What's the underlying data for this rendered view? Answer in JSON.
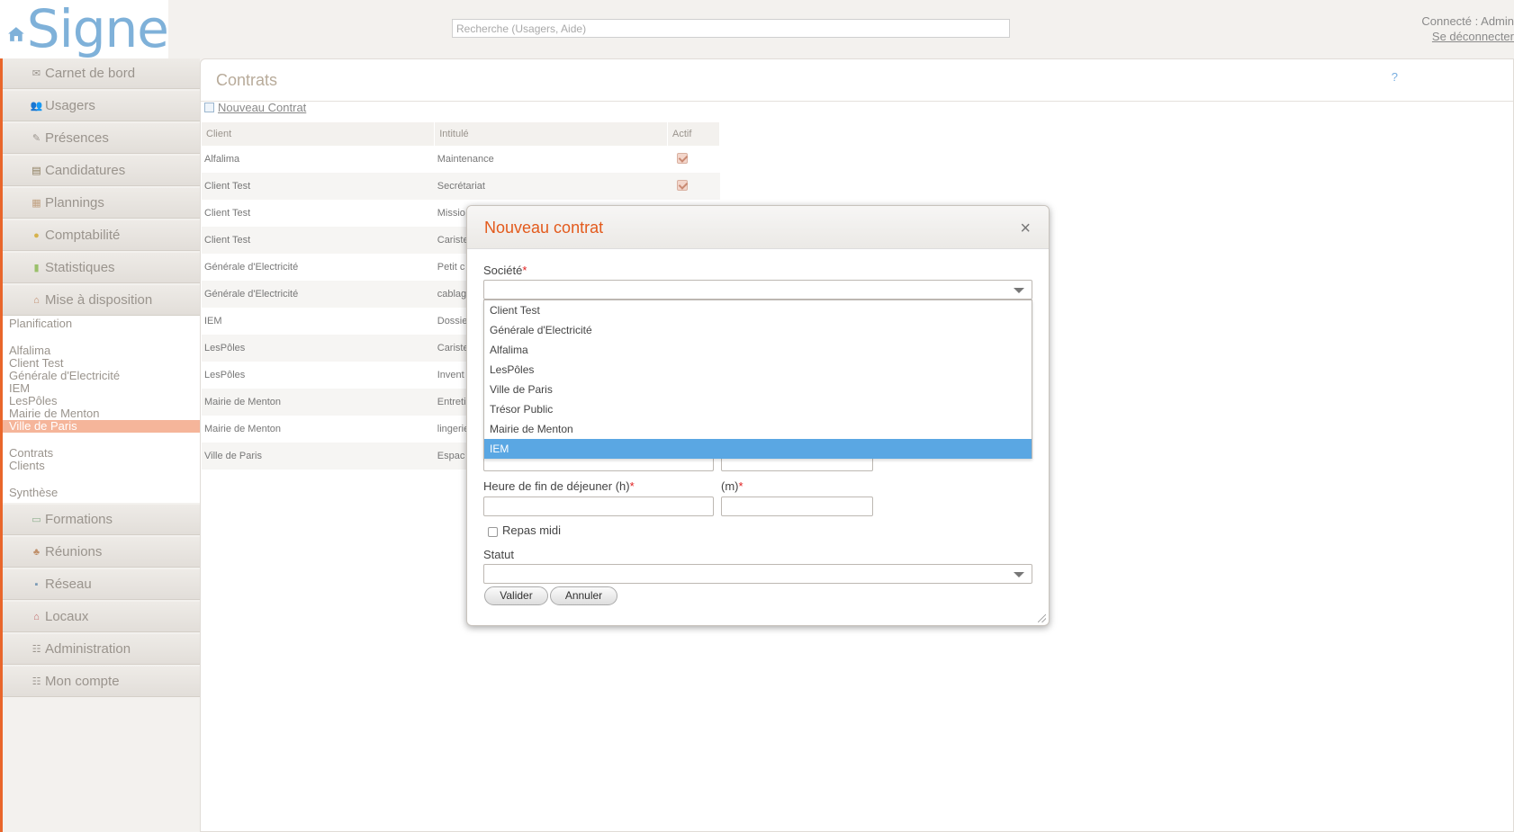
{
  "header": {
    "logo_text": "Signe",
    "search_placeholder": "Recherche (Usagers, Aide)",
    "connected_label": "Connecté : Admin",
    "logout_label": "Se déconnecter"
  },
  "sidebar": {
    "nav_top": [
      {
        "label": "Carnet de bord",
        "icon": "envelope-icon"
      },
      {
        "label": "Usagers",
        "icon": "users-icon"
      },
      {
        "label": "Présences",
        "icon": "pen-icon"
      },
      {
        "label": "Candidatures",
        "icon": "folder-icon"
      },
      {
        "label": "Plannings",
        "icon": "calendar-icon"
      },
      {
        "label": "Comptabilité",
        "icon": "coins-icon"
      },
      {
        "label": "Statistiques",
        "icon": "bar-chart-icon"
      },
      {
        "label": "Mise à disposition",
        "icon": "house-icon"
      }
    ],
    "panel": {
      "section_planification": "Planification",
      "clients": [
        "Alfalima",
        "Client Test",
        "Générale d'Electricité",
        "IEM",
        "LesPôles",
        "Mairie de Menton",
        "Ville de Paris"
      ],
      "selected_client": "Ville de Paris",
      "contracts_link": "Contrats",
      "clients_link": "Clients",
      "section_synthese": "Synthèse"
    },
    "nav_bottom": [
      {
        "label": "Formations",
        "icon": "board-icon"
      },
      {
        "label": "Réunions",
        "icon": "meeting-icon"
      },
      {
        "label": "Réseau",
        "icon": "network-icon"
      },
      {
        "label": "Locaux",
        "icon": "building-icon"
      },
      {
        "label": "Administration",
        "icon": "list-icon"
      },
      {
        "label": "Mon compte",
        "icon": "list-icon"
      }
    ]
  },
  "main": {
    "title": "Contrats",
    "help_label": "?",
    "new_contract_link": "Nouveau Contrat",
    "table": {
      "headers": [
        "Client",
        "Intitulé",
        "Actif"
      ],
      "rows": [
        {
          "client": "Alfalima",
          "title": "Maintenance",
          "active": true
        },
        {
          "client": "Client Test",
          "title": "Secrétariat",
          "active": true
        },
        {
          "client": "Client Test",
          "title": "Missio",
          "active": false
        },
        {
          "client": "Client Test",
          "title": "Cariste",
          "active": false
        },
        {
          "client": "Générale d'Electricité",
          "title": "Petit c",
          "active": false
        },
        {
          "client": "Générale d'Electricité",
          "title": "cablag",
          "active": false
        },
        {
          "client": "IEM",
          "title": "Dossie",
          "active": false
        },
        {
          "client": "LesPôles",
          "title": "Cariste",
          "active": false
        },
        {
          "client": "LesPôles",
          "title": "Invent",
          "active": false
        },
        {
          "client": "Mairie de Menton",
          "title": "Entreti",
          "active": false
        },
        {
          "client": "Mairie de Menton",
          "title": "lingerie",
          "active": false
        },
        {
          "client": "Ville de Paris",
          "title": "Espac",
          "active": false
        }
      ]
    }
  },
  "modal": {
    "title": "Nouveau contrat",
    "close_label": "×",
    "societe_label": "Société",
    "required_mark": "*",
    "societe_options": [
      "Client Test",
      "Générale d'Electricité",
      "Alfalima",
      "LesPôles",
      "Ville de Paris",
      "Trésor Public",
      "Mairie de Menton",
      "IEM"
    ],
    "societe_highlighted": "IEM",
    "lunch_end_h_label": "Heure de fin de déjeuner (h)",
    "lunch_end_m_label": "(m)",
    "repas_midi_label": "Repas midi",
    "statut_label": "Statut",
    "valider_label": "Valider",
    "annuler_label": "Annuler"
  }
}
